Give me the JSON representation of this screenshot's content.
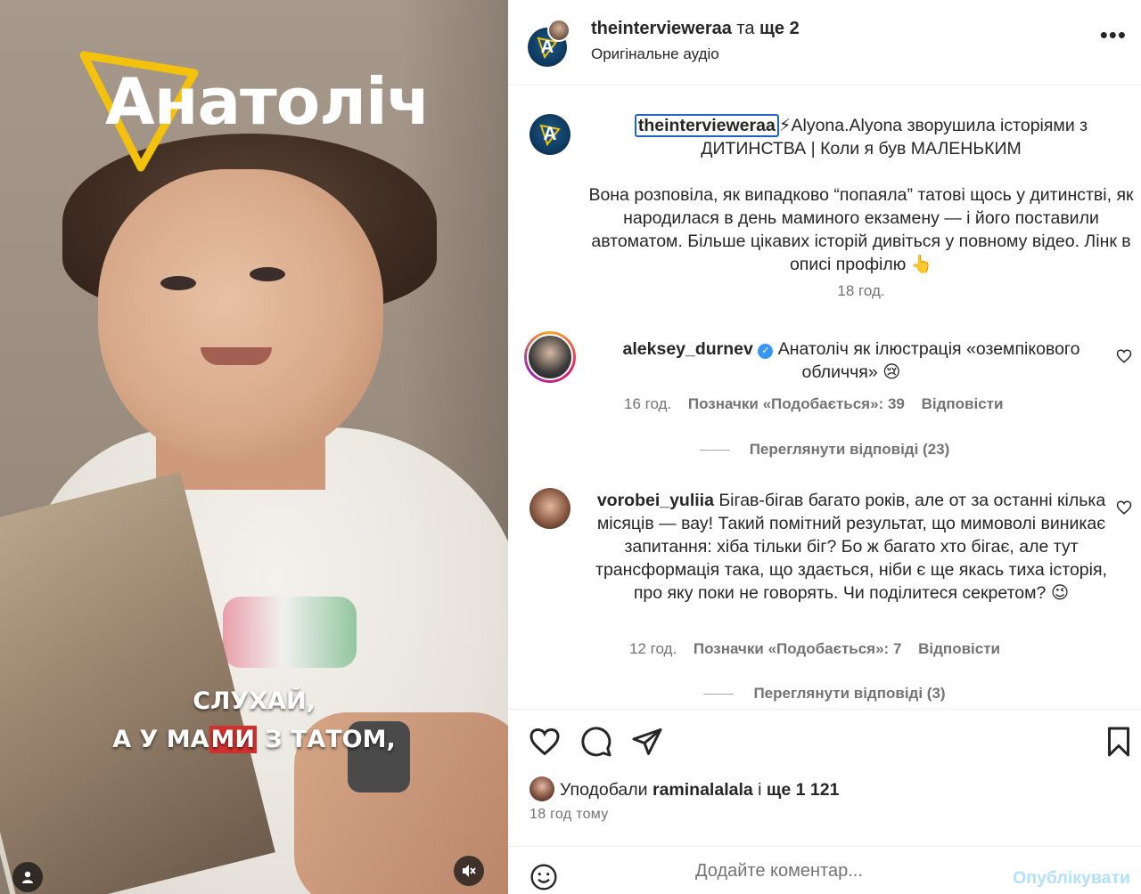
{
  "video": {
    "logo_text": "Анатоліч",
    "subtitle_line1": "СЛУХАЙ,",
    "subtitle_line2_pre": "А У МА",
    "subtitle_line2_hl": "МИ",
    "subtitle_line2_post": " З ТАТОМ,",
    "profile_icon": "user-icon",
    "mute_icon": "speaker-muted-icon",
    "colors": {
      "logo_accent": "#f4c20d",
      "subtitle_highlight": "#d0312d"
    }
  },
  "header": {
    "username": "theintervieweraa",
    "joiner": "та",
    "others": "ще 2",
    "audio": "Оригінальне аудіо",
    "more_icon": "more-options-icon",
    "more_label": "•••"
  },
  "caption": {
    "username": "theintervieweraa",
    "title": "⚡Alyona.Alyona зворушила історіями з ДИТИНСТВА | Коли я був МАЛЕНЬКИМ",
    "body": "Вона розповіла, як випадково “попаяла” татові щось у дитинстві, як народилася в день маминого екзамену — і його поставили автоматом. Більше цікавих історій дивіться у повному відео. Лінк в описі профілю 👆",
    "time": "18 год."
  },
  "comments": [
    {
      "username": "aleksey_durnev",
      "verified": true,
      "text": "Анатоліч як ілюстрація «оземпікового обличчя» 😢",
      "time": "16 год.",
      "likes": "Позначки «Подобається»: 39",
      "reply": "Відповісти",
      "view_replies": "Переглянути відповіді (23)"
    },
    {
      "username": "vorobei_yuliia",
      "verified": false,
      "text": "Бігав-бігав багато років, але от за останні кілька місяців — вау! Такий помітний результат, що мимоволі виникає запитання: хіба тільки біг? Бо ж багато хто бігає, але тут трансформація така, що здається, ніби є ще якась тиха історія, про яку поки не говорять. Чи поділитеся секретом? 😉",
      "time": "12 год.",
      "likes": "Позначки «Подобається»: 7",
      "reply": "Відповісти",
      "view_replies": "Переглянути відповіді (3)"
    }
  ],
  "actions": {
    "like_icon": "heart-icon",
    "comment_icon": "comment-icon",
    "share_icon": "send-icon",
    "save_icon": "bookmark-icon"
  },
  "likes": {
    "prefix": "Уподобали",
    "user": "raminalalala",
    "joiner": "і",
    "count": "ще 1 121",
    "ago": "18 год тому"
  },
  "composer": {
    "emoji_icon": "emoji-icon",
    "placeholder": "Додайте коментар...",
    "publish": "Опублікувати"
  }
}
